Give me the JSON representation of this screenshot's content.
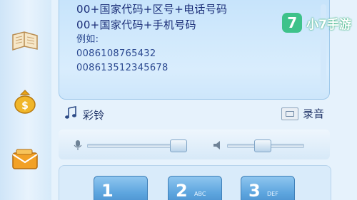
{
  "sidebar": {
    "items": [
      {
        "icon": "book-icon"
      },
      {
        "icon": "money-bag-icon"
      },
      {
        "icon": "envelope-icon"
      }
    ]
  },
  "info": {
    "line1": "00+国家代码+区号+电话号码",
    "line2": "00+国家代码+手机号码",
    "example_label": "例如:",
    "example1": "0086108765432",
    "example2": "008613512345678"
  },
  "actions": {
    "ring_label": "彩铃",
    "record_label": "录音"
  },
  "volume": {
    "mic_level": 0.88,
    "speaker_level": 0.46
  },
  "dialpad": {
    "keys": [
      {
        "num": "1",
        "sub": ""
      },
      {
        "num": "2",
        "sub": "ABC"
      },
      {
        "num": "3",
        "sub": "DEF"
      }
    ]
  },
  "watermark": {
    "logo": "7",
    "text": "小7手游"
  },
  "colors": {
    "panel": "#c7e4fb",
    "text": "#15347a",
    "key": "#5ea6df",
    "watermark": "#3ec28a"
  }
}
